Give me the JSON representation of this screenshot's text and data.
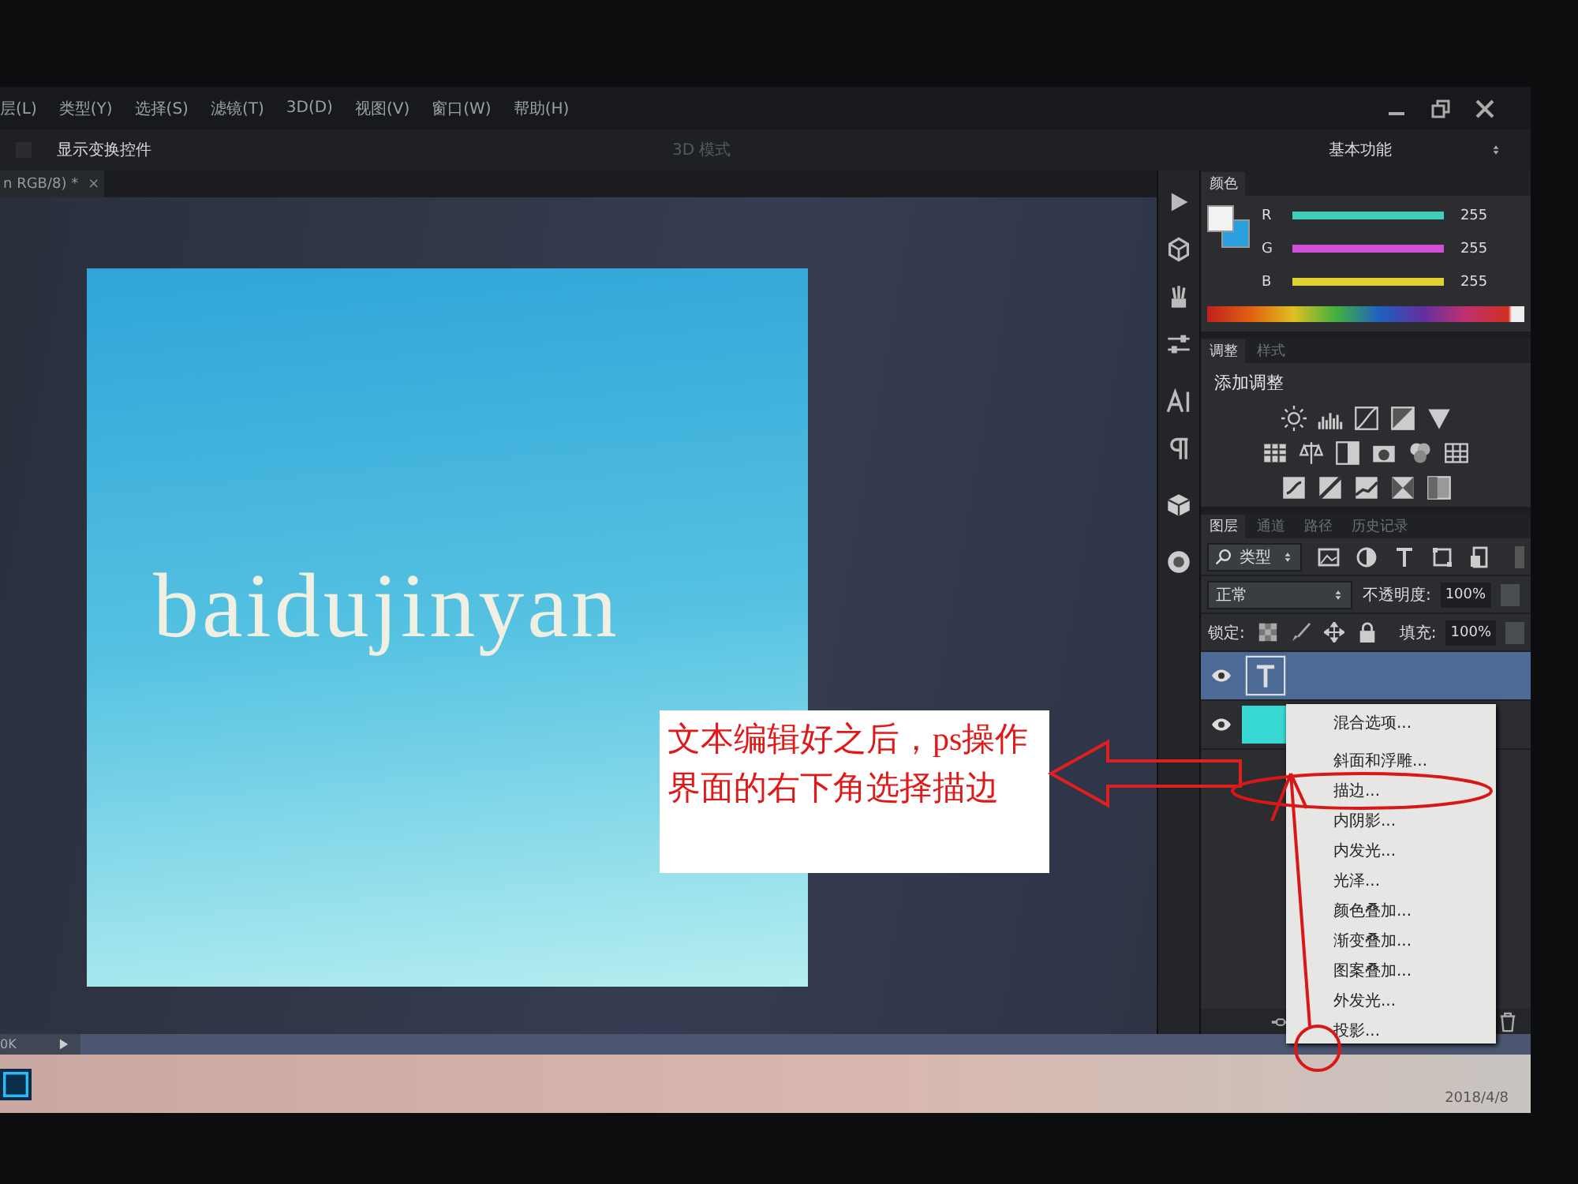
{
  "menu_bar": {
    "items": [
      {
        "label": "层(L)"
      },
      {
        "label": "类型(Y)"
      },
      {
        "label": "选择(S)"
      },
      {
        "label": "滤镜(T)"
      },
      {
        "label": "3D(D)"
      },
      {
        "label": "视图(V)"
      },
      {
        "label": "窗口(W)"
      },
      {
        "label": "帮助(H)"
      }
    ]
  },
  "options_bar": {
    "show_transform_checked": false,
    "show_transform_controls": "显示变换控件",
    "mode_3d": "3D 模式",
    "workspace": "基本功能"
  },
  "document_tab": {
    "title": "n RGB/8) *",
    "close": "×"
  },
  "canvas": {
    "text": "baidujinyan"
  },
  "color_panel": {
    "title": "颜色",
    "channels": [
      {
        "name": "R",
        "value": "255",
        "level": 1,
        "color": "#3ed0b8"
      },
      {
        "name": "G",
        "value": "255",
        "level": 1,
        "color": "#d050d8"
      },
      {
        "name": "B",
        "value": "255",
        "level": 1,
        "color": "#e0d030"
      }
    ]
  },
  "adjustments_panel": {
    "tabs": [
      {
        "label": "调整",
        "selected": true
      },
      {
        "label": "样式",
        "selected": false
      }
    ],
    "heading": "添加调整"
  },
  "layers_panel": {
    "tabs": [
      {
        "label": "图层",
        "selected": true
      },
      {
        "label": "通道",
        "selected": false
      },
      {
        "label": "路径",
        "selected": false
      },
      {
        "label": "历史记录",
        "selected": false
      }
    ],
    "filter": "类型",
    "blend_mode": "正常",
    "opacity_label": "不透明度:",
    "opacity": "100%",
    "lock_label": "锁定:",
    "fill_label": "填充:",
    "fill": "100%",
    "layers": [
      {
        "kind": "text",
        "selected": true
      },
      {
        "kind": "fill",
        "selected": false
      }
    ]
  },
  "context_menu": {
    "items": [
      {
        "label": "混合选项..."
      },
      {
        "label": "斜面和浮雕..."
      },
      {
        "label": "描边..."
      },
      {
        "label": "内阴影..."
      },
      {
        "label": "内发光..."
      },
      {
        "label": "光泽..."
      },
      {
        "label": "颜色叠加..."
      },
      {
        "label": "渐变叠加..."
      },
      {
        "label": "图案叠加..."
      },
      {
        "label": "外发光..."
      },
      {
        "label": "投影..."
      }
    ]
  },
  "status_bar": {
    "text": "0K"
  },
  "taskbar": {
    "date": "2018/4/8"
  },
  "annotation": {
    "text": "文本编辑好之后，ps操作界面的右下角选择描边"
  }
}
